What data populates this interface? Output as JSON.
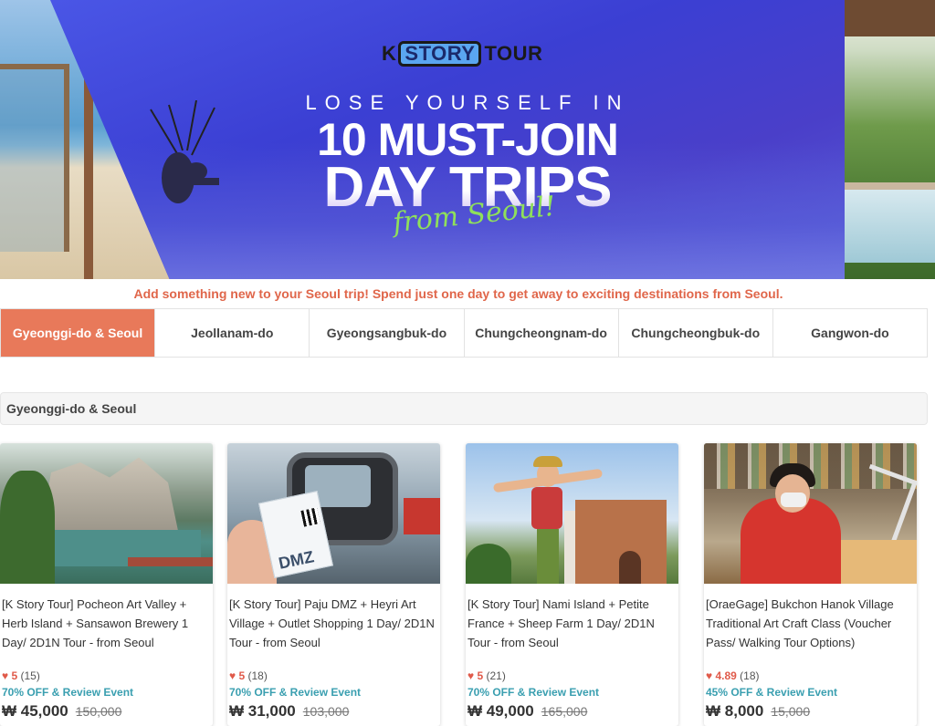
{
  "hero": {
    "logo_k": "K",
    "logo_story": "STORY",
    "logo_tour": "TOUR",
    "tagline": "LOSE YOURSELF IN",
    "headline_line1": "10 MUST-JOIN",
    "headline_line2": "DAY TRIPS",
    "script": "from Seoul!"
  },
  "intro_text": "Add something new to your Seoul trip! Spend just one day to get away to exciting destinations from Seoul.",
  "tabs": [
    {
      "label": "Gyeonggi-do & Seoul",
      "active": true
    },
    {
      "label": "Jeollanam-do",
      "active": false
    },
    {
      "label": "Gyeongsangbuk-do",
      "active": false
    },
    {
      "label": "Chungcheongnam-do",
      "active": false
    },
    {
      "label": "Chungcheongbuk-do",
      "active": false
    },
    {
      "label": "Gangwon-do",
      "active": false
    }
  ],
  "section_title": "Gyeonggi-do & Seoul",
  "products": [
    {
      "title": "[K Story Tour] Pocheon Art Valley + Herb Island + Sansawon Brewery 1 Day/ 2D1N Tour - from Seoul",
      "rating": "5",
      "reviews": "(15)",
      "promo": "70% OFF & Review Event",
      "price": "₩ 45,000",
      "original_price": "150,000"
    },
    {
      "title": "[K Story Tour] Paju DMZ + Heyri Art Village + Outlet Shopping 1 Day/ 2D1N Tour - from Seoul",
      "rating": "5",
      "reviews": "(18)",
      "promo": "70% OFF & Review Event",
      "price": "₩ 31,000",
      "original_price": "103,000",
      "image_text": "DMZ"
    },
    {
      "title": "[K Story Tour] Nami Island + Petite France + Sheep Farm 1 Day/ 2D1N Tour - from Seoul",
      "rating": "5",
      "reviews": "(21)",
      "promo": "70% OFF & Review Event",
      "price": "₩ 49,000",
      "original_price": "165,000"
    },
    {
      "title": "[OraeGage] Bukchon Hanok Village Traditional Art Craft Class (Voucher Pass/ Walking Tour Options)",
      "rating": "4.89",
      "reviews": "(18)",
      "promo": "45% OFF & Review Event",
      "price": "₩ 8,000",
      "original_price": "15,000"
    }
  ],
  "colors": {
    "accent": "#e8795a",
    "intro": "#e0664a",
    "promo": "#3a9fb0",
    "heart": "#e05a4a",
    "hero_blue": "#3b3fd3"
  },
  "icons": [
    "heart-icon"
  ]
}
